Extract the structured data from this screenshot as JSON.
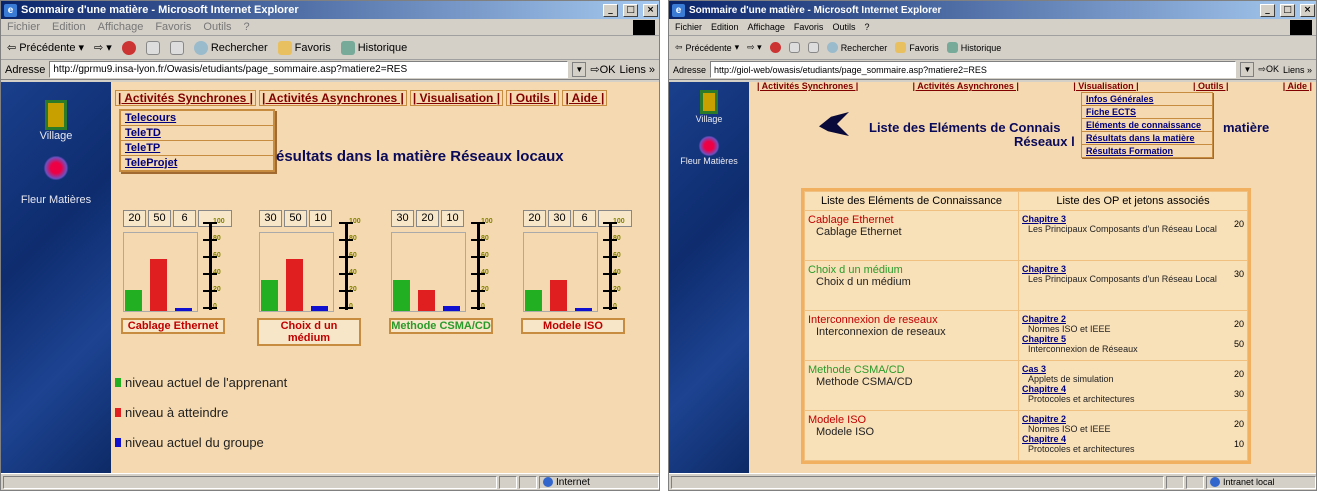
{
  "left": {
    "title": "Sommaire d'une matière - Microsoft Internet Explorer",
    "menu": [
      "Fichier",
      "Edition",
      "Affichage",
      "Favoris",
      "Outils",
      "?"
    ],
    "toolbar": {
      "back": "Précédente",
      "search": "Rechercher",
      "favorites": "Favoris",
      "history": "Historique"
    },
    "address_label": "Adresse",
    "url": "http://gprmu9.insa-lyon.fr/Owasis/etudiants/page_sommaire.asp?matiere2=RES",
    "go": "OK",
    "links": "Liens »",
    "side": {
      "village": "Village",
      "fleur": "Fleur Matières"
    },
    "nav": [
      "| Activités Synchrones |",
      "| Activités Asynchrones |",
      "| Visualisation |",
      "| Outils |",
      "| Aide |"
    ],
    "dropdown": [
      "Telecours",
      "TeleTD",
      "TeleTP",
      "TeleProjet"
    ],
    "heading": "ésultats dans la matière Réseaux locaux",
    "scale_labels": [
      "100",
      "80",
      "60",
      "40",
      "20",
      "0"
    ],
    "gauges": [
      {
        "nums": [
          "20",
          "50",
          "6",
          ""
        ],
        "label": "Cablage Ethernet",
        "label_color": "#c00000",
        "values": [
          20,
          50,
          6
        ]
      },
      {
        "nums": [
          "30",
          "50",
          "10"
        ],
        "label": "Choix d un médium",
        "label_color": "#c00000",
        "values": [
          30,
          50,
          10
        ]
      },
      {
        "nums": [
          "30",
          "20",
          "10"
        ],
        "label": "Methode CSMA/CD",
        "label_color": "#2a9a2a",
        "values": [
          30,
          20,
          10
        ]
      },
      {
        "nums": [
          "20",
          "30",
          "6",
          ""
        ],
        "label": "Modele ISO",
        "label_color": "#c00000",
        "values": [
          20,
          30,
          6
        ]
      }
    ],
    "legend": [
      "niveau actuel de l'apprenant",
      "niveau à atteindre",
      "niveau actuel du groupe"
    ],
    "status": "Internet"
  },
  "right": {
    "title": "Sommaire d'une matière - Microsoft Internet Explorer",
    "menu": [
      "Fichier",
      "Edition",
      "Affichage",
      "Favoris",
      "Outils",
      "?"
    ],
    "toolbar": {
      "back": "Précédente",
      "search": "Rechercher",
      "favorites": "Favoris",
      "history": "Historique"
    },
    "address_label": "Adresse",
    "url": "http://giol-web/owasis/etudiants/page_sommaire.asp?matiere2=RES",
    "go": "OK",
    "links": "Liens »",
    "side": {
      "village": "Village",
      "fleur": "Fleur Matières"
    },
    "nav": [
      "| Activités Synchrones |",
      "| Activités Asynchrones |",
      "| Visualisation |",
      "| Outils |",
      "| Aide |"
    ],
    "dropdown": [
      "Infos Générales",
      "Fiche ECTS",
      "Eléments de connaissance",
      "Résultats dans la matière",
      "Résultats Formation"
    ],
    "heading_a": "Liste des Eléments de Connais",
    "heading_b": "matière",
    "heading_c": "Réseaux l",
    "table_head": [
      "Liste des Eléments de Connaissance",
      "Liste des OP et jetons associés"
    ],
    "rows": [
      {
        "title": "Cablage Ethernet",
        "sub": "Cablage Ethernet",
        "color": "#c00000",
        "refs": [
          {
            "chap": "Chapitre 3",
            "desc": "Les Principaux Composants d'un Réseau Local",
            "val": "20"
          }
        ]
      },
      {
        "title": "Choix d un médium",
        "sub": "Choix d un médium",
        "color": "#2a9a2a",
        "refs": [
          {
            "chap": "Chapitre 3",
            "desc": "Les Principaux Composants d'un Réseau Local",
            "val": "30"
          }
        ]
      },
      {
        "title": "Interconnexion de reseaux",
        "sub": "Interconnexion de reseaux",
        "color": "#c00000",
        "refs": [
          {
            "chap": "Chapitre 2",
            "desc": "Normes ISO et IEEE",
            "val": "20"
          },
          {
            "chap": "Chapitre 5",
            "desc": "Interconnexion de Réseaux",
            "val": "50"
          }
        ]
      },
      {
        "title": "Methode CSMA/CD",
        "sub": "Methode CSMA/CD",
        "color": "#2a9a2a",
        "refs": [
          {
            "chap": "Cas 3",
            "desc": "Applets de simulation",
            "val": "20"
          },
          {
            "chap": "Chapitre 4",
            "desc": "Protocoles et architectures",
            "val": "30"
          }
        ]
      },
      {
        "title": "Modele ISO",
        "sub": "Modele ISO",
        "color": "#c00000",
        "refs": [
          {
            "chap": "Chapitre 2",
            "desc": "Normes ISO et IEEE",
            "val": "20"
          },
          {
            "chap": "Chapitre 4",
            "desc": "Protocoles et architectures",
            "val": "10"
          }
        ]
      }
    ],
    "status": "Intranet local"
  }
}
